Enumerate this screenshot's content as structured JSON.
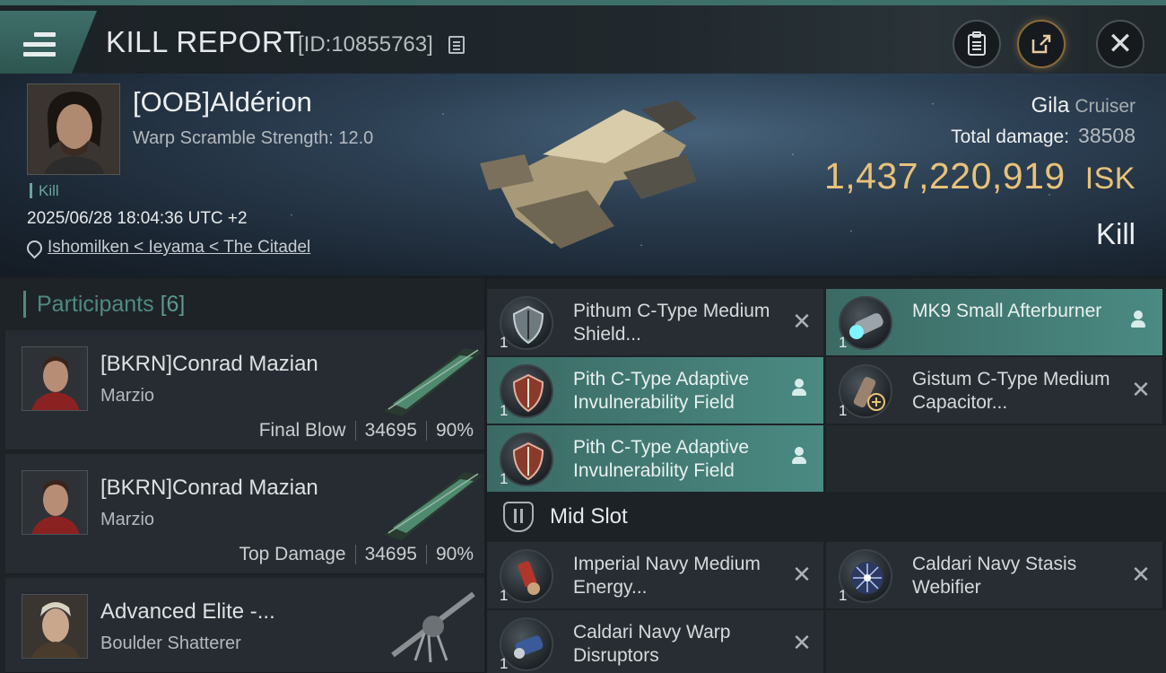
{
  "header": {
    "title": "KILL REPORT",
    "report_id": "[ID:10855763]"
  },
  "victim": {
    "name": "[OOB]Aldérion",
    "warp_scramble": "Warp Scramble Strength: 12.0",
    "tag": "Kill",
    "datetime": "2025/06/28 18:04:36 UTC +2",
    "location": "Ishomilken < Ieyama < The Citadel",
    "ship_name": "Gila",
    "ship_class": "Cruiser",
    "damage_label": "Total damage:",
    "damage_value": "38508",
    "isk_value": "1,437,220,919",
    "isk_unit": "ISK",
    "result": "Kill"
  },
  "participants": {
    "label": "Participants",
    "count": "[6]",
    "rows": [
      {
        "name": "[BKRN]Conrad Mazian",
        "ship": "Marzio",
        "role": "Final Blow",
        "damage": "34695",
        "percent": "90%"
      },
      {
        "name": "[BKRN]Conrad Mazian",
        "ship": "Marzio",
        "role": "Top Damage",
        "damage": "34695",
        "percent": "90%"
      },
      {
        "name": "Advanced Elite -...",
        "ship": "Boulder Shatterer"
      }
    ]
  },
  "modules": {
    "low": [
      {
        "qty": "1",
        "name": "Pithum C-Type Medium Shield...",
        "status": "destroyed"
      },
      {
        "qty": "1",
        "name": "MK9 Small Afterburner",
        "status": "dropped"
      },
      {
        "qty": "1",
        "name": "Pith C-Type Adaptive Invulnerability Field",
        "status": "dropped"
      },
      {
        "qty": "1",
        "name": "Gistum C-Type Medium Capacitor...",
        "status": "destroyed"
      },
      {
        "qty": "1",
        "name": "Pith C-Type Adaptive Invulnerability Field",
        "status": "dropped"
      }
    ],
    "mid_slot_label": "Mid Slot",
    "mid": [
      {
        "qty": "1",
        "name": "Imperial Navy Medium Energy...",
        "status": "destroyed"
      },
      {
        "qty": "1",
        "name": "Caldari Navy Stasis Webifier",
        "status": "destroyed"
      },
      {
        "qty": "1",
        "name": "Caldari Navy Warp Disruptors",
        "status": "destroyed"
      }
    ]
  },
  "icons": {
    "menu": "menu-icon",
    "copy": "copy-icon",
    "clipboard": "clipboard-icon",
    "share": "share-icon",
    "close": "close-icon",
    "location": "location-pin-icon",
    "dropped": "person-icon",
    "destroyed": "close-icon"
  },
  "colors": {
    "accent": "#4f8a82",
    "isk": "#e8c27a",
    "dropped_bg": "#4a8a82"
  }
}
